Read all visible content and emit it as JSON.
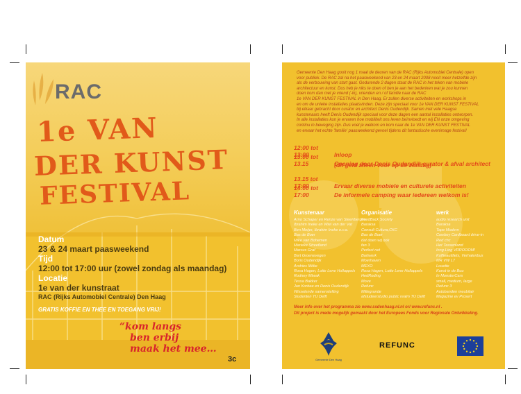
{
  "left_flyer": {
    "logo": "RAC",
    "title_lines": [
      "1e VAN",
      "DER KUNST",
      "FESTIVAL"
    ],
    "datum_label": "Datum",
    "datum_value": "23 & 24 maart paasweekend",
    "tijd_label": "Tijd",
    "tijd_value": "12:00 tot 17:00 uur (zowel zondag als maandag)",
    "locatie_label": "Locatie",
    "locatie_value": "1e van der kunstraat",
    "locatie_detail": "RAC (Rijks Automobiel Centrale) Den Haag",
    "free_text": "GRATIS KOFFIE EN THEE EN TOEGANG VRIJ!",
    "slogan_lines": [
      "“kom langs",
      "ben erbij",
      "maak het mee…"
    ],
    "mark": "3c"
  },
  "right_flyer": {
    "intro": [
      "Gemeente Den Haag gooit nog 1 maal de deuren van de RAC (Rijks Automobiel Centrale) open",
      "voor publiek. De RAC zal na het paasweekend van 23 en 24 maart 2008 nooit meer hetzelfde zijn",
      "als de verbouwing van start gaat. Gedurende 2 dagen staat de RAC in het teken van mobiele",
      "architectuur en kunst. Dus heb je niks te doen of ben je aan het bedenken wat je zou kunnen",
      "doen kom dan met je vriend (-in), vrienden en / of familie naar de RAC",
      "1e VAN DER KUNST FESTIVAL in Den Haag. Er zullen diverse activiteiten en workshops in",
      "en om de unieke installaties plaatsvinden. Deze zijn speciaal voor 1e VAN DER KUNST FESTIVAL",
      "bij elkaar gebracht door curator en architect Denis Oudendijk. Samen met vele Haagse",
      "kunstenaars heeft Denis Oudendijk speciaal voor deze dagen een aantal installaties ontworpen.",
      "In alle installaties kun je ervaren hoe mobiliteit ons leven beïnvloedt en wij EN onze omgeving",
      "continu in beweging zijn. Dus voel je welkom en kom naar de 1e VAN DER KUNST FESTIVAL",
      "en ervaar het echte 'familie' paasweekend gevoel tijdens dit fantastische evenimage festival!"
    ],
    "schedule": [
      {
        "time": "12:00 tot 13:00",
        "desc": "Inloop"
      },
      {
        "time": "13:00 tot 13.15",
        "desc": "Opening door Denis Oudendijk curator & afval architect"
      },
      {
        "time": "",
        "desc": "(dit geld alleen voor op de zondag)"
      },
      {
        "time": "13.15 tot 17:00",
        "desc": "Ervaar diverse mobiele en culturele activiteiten"
      },
      {
        "time": "14:00 tot 17:00",
        "desc": "De informele camping waar iedereen welkom is!"
      }
    ],
    "columns": {
      "kunstenaar_head": "Kunstenaar",
      "organisatie_head": "Organisatie",
      "werk_head": "werk",
      "kunstenaar": [
        "Arno Schaper en Renze van Steenbergen",
        "Ibrahim Ineke en Wiel van der Vat",
        "Ben Meijer, Ibrahim Ineke e.v.a.",
        "Bas de Boer",
        "Mike van Bohemen",
        "Marieke Streefland",
        "Marcus Graf",
        "Bart Groenevegen",
        "Boris Oudendijk",
        "Andries Mitke",
        "Rosa Hagen, Lotte Lene Hollappels",
        "Rodney Mtwak",
        "Tessa Bakker",
        "Jan Korbee en Denis Oudendijk",
        "Wisselende samenstelling",
        "Studenten TU Delft"
      ],
      "organisatie": [
        "FeedBack Society",
        "Baraksa",
        "Consult Cultura,CKC",
        "Bas de Boer",
        "dat doen wij ook",
        "fan 3",
        "Perfect net",
        "Bartwerk",
        "Moerhaven",
        "MEXO",
        "Rosa Hagen, Lotte Lene Hollappels",
        "HedRoding",
        "Move",
        "Refunc",
        "Millegrande",
        "afstudeerstudio public realm TU Delft"
      ],
      "werk": [
        "audio research unit",
        "Baraksa",
        "Tape Modern",
        "Cowboy Cardboard drive-in",
        "Red chc",
        "Het Tassenland",
        "Inng-Ling VRROOOM!",
        "Koffieautiliets, Verhalenbus",
        "MR VW L7",
        "Louette",
        "Kunst in de Buu",
        "In MonsterCars",
        "small, medium, large",
        "Refunc 3",
        "Autobanden meubilair",
        "Magazine ev Prosert"
      ]
    },
    "footer_line1": "Meer info over het programma zie www.ssdenhaag.nl.nl or/ www.refunc.nl .",
    "footer_line2": "Dit project is mede mogelijk gemaakt door het Europees Fonds voor Regionale Ontwikkeling.",
    "logo_gemeente": "Gemeente Den Haag",
    "logo_refunc": "REFUNC"
  },
  "colors": {
    "flyer_yellow": "#f2c12e",
    "title_orange": "#e15a1a",
    "slogan_red": "#d8242b",
    "text_rust": "#b4421a",
    "eu_blue": "#1c3f9a"
  }
}
